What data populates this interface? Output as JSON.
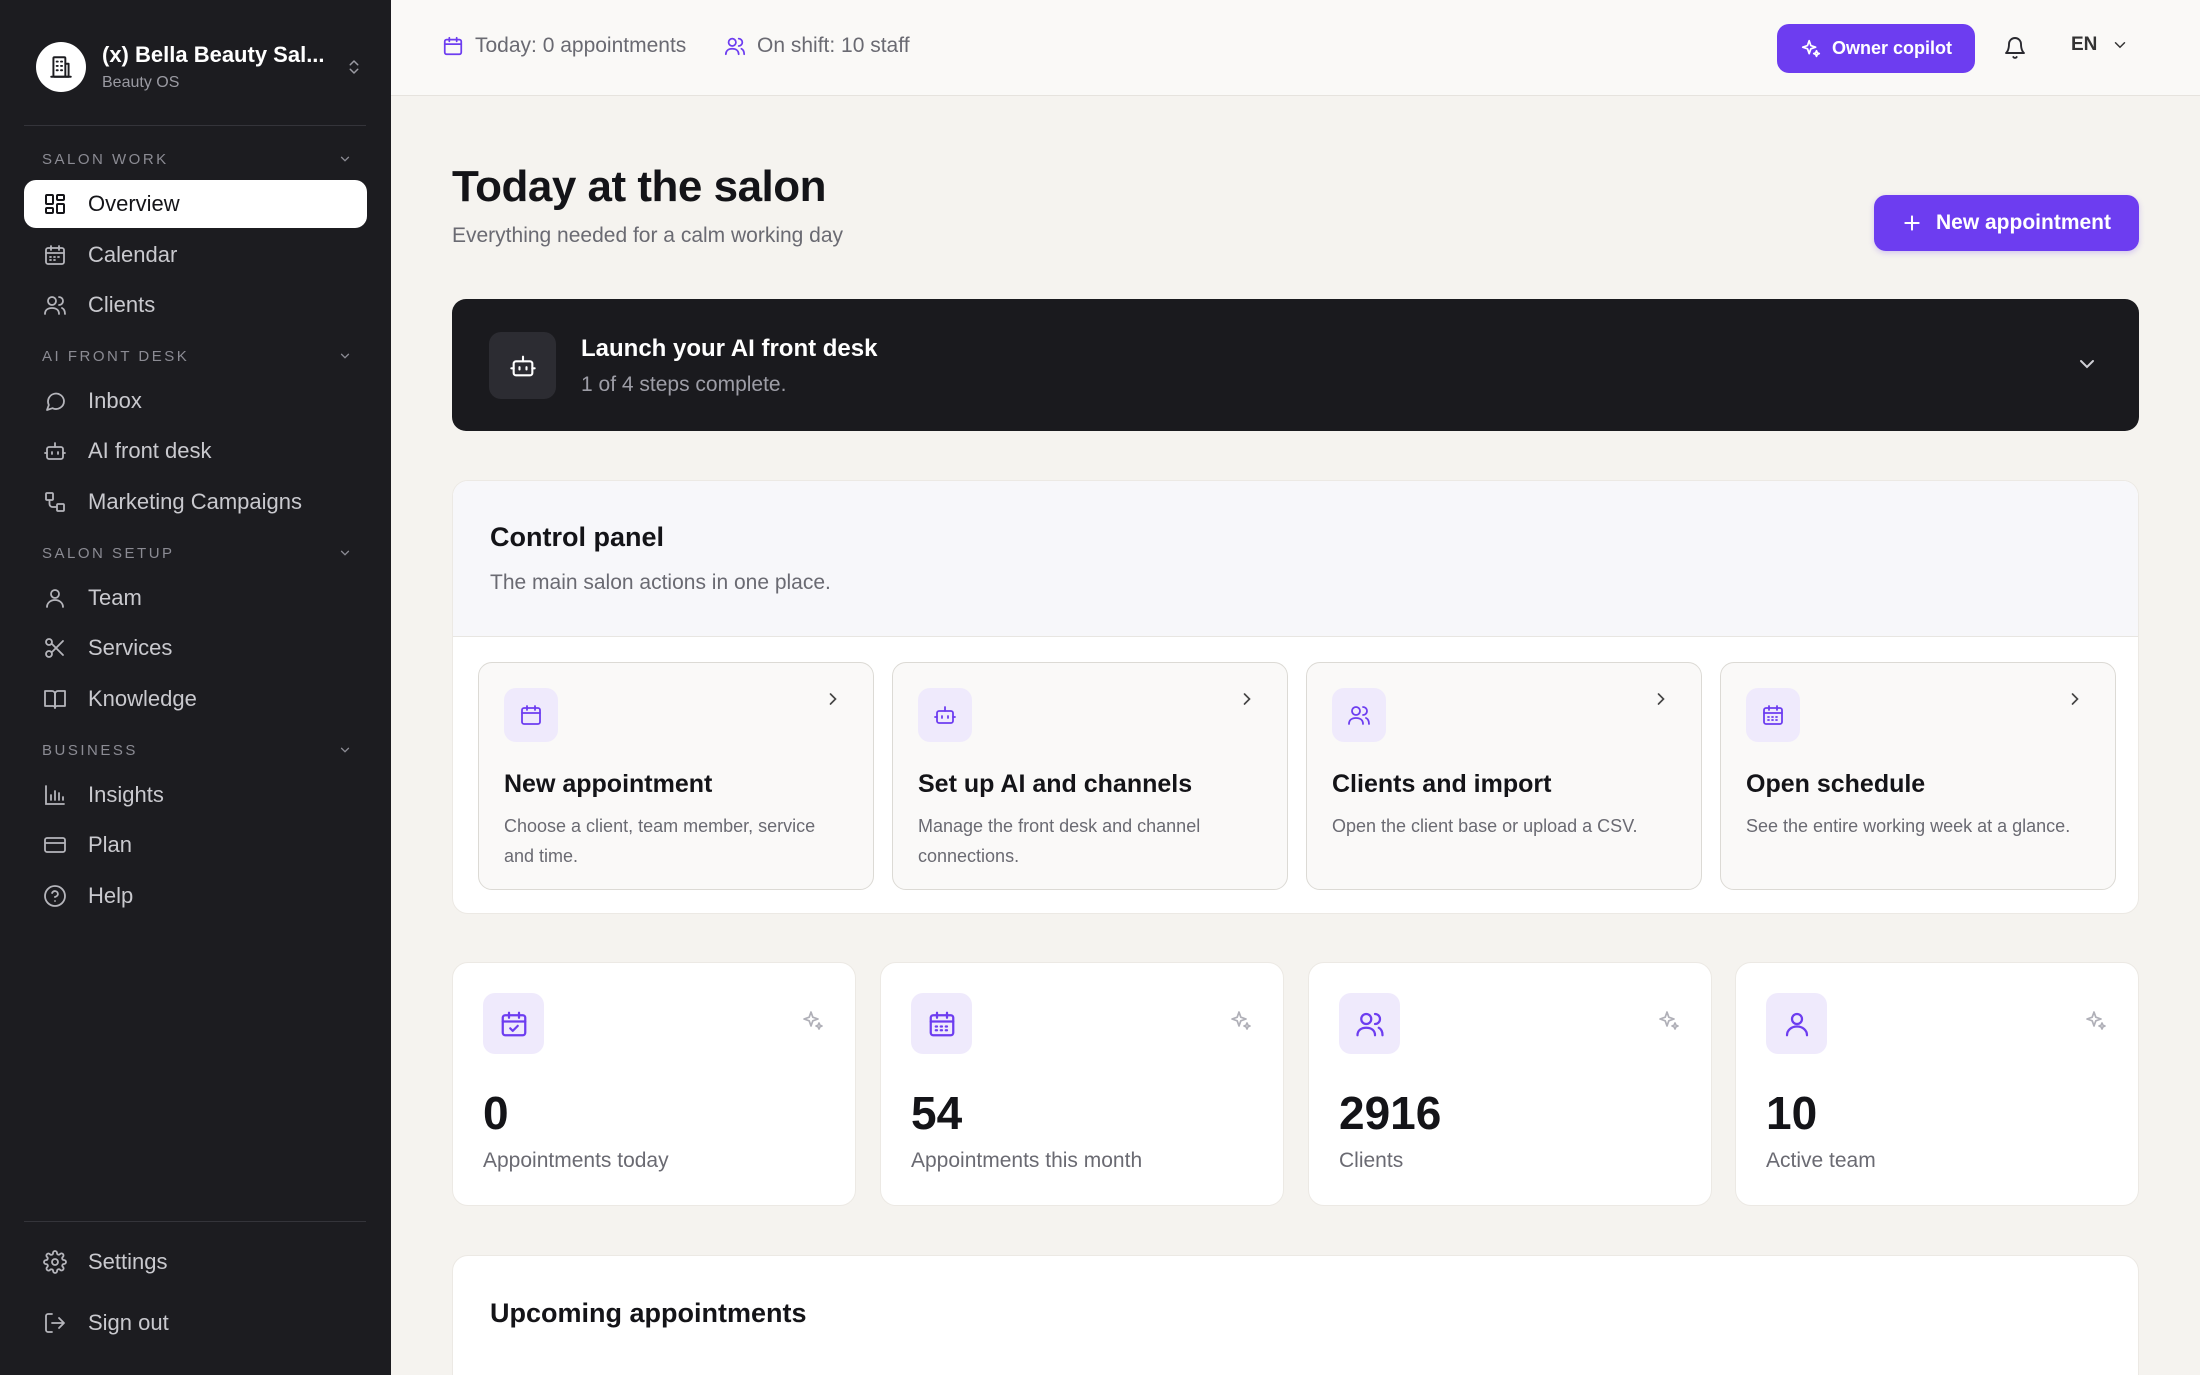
{
  "brand": {
    "name": "(x) Bella Beauty Sal...",
    "subtitle": "Beauty OS"
  },
  "sidebar": {
    "sections": [
      {
        "title": "SALON WORK",
        "items": [
          {
            "label": "Overview",
            "icon": "overview-icon",
            "active": true
          },
          {
            "label": "Calendar",
            "icon": "calendar-icon"
          },
          {
            "label": "Clients",
            "icon": "clients-icon"
          }
        ]
      },
      {
        "title": "AI FRONT DESK",
        "items": [
          {
            "label": "Inbox",
            "icon": "chat-bubble-icon"
          },
          {
            "label": "AI front desk",
            "icon": "robot-icon"
          },
          {
            "label": "Marketing Campaigns",
            "icon": "campaigns-icon"
          }
        ]
      },
      {
        "title": "SALON SETUP",
        "items": [
          {
            "label": "Team",
            "icon": "person-icon"
          },
          {
            "label": "Services",
            "icon": "scissors-icon"
          },
          {
            "label": "Knowledge",
            "icon": "book-icon"
          }
        ]
      },
      {
        "title": "BUSINESS",
        "items": [
          {
            "label": "Insights",
            "icon": "bar-chart-icon"
          },
          {
            "label": "Plan",
            "icon": "credit-card-icon"
          },
          {
            "label": "Help",
            "icon": "help-circle-icon"
          }
        ]
      }
    ],
    "footer": {
      "settings": "Settings",
      "sign_out": "Sign out"
    }
  },
  "topbar": {
    "today": "Today: 0 appointments",
    "shift": "On shift: 10 staff",
    "copilot": "Owner copilot",
    "language": "EN"
  },
  "page": {
    "title": "Today at the salon",
    "subtitle": "Everything needed for a calm working day",
    "new_appointment": "New appointment"
  },
  "launch": {
    "title": "Launch your AI front desk",
    "progress": "1 of 4 steps complete.",
    "steps_done": 1,
    "steps_total": 4
  },
  "control": {
    "title": "Control panel",
    "subtitle": "The main salon actions in one place.",
    "actions": [
      {
        "title": "New appointment",
        "desc": "Choose a client, team member, service and time.",
        "icon": "calendar-icon"
      },
      {
        "title": "Set up AI and channels",
        "desc": "Manage the front desk and channel connections.",
        "icon": "robot-icon"
      },
      {
        "title": "Clients and import",
        "desc": "Open the client base or upload a CSV.",
        "icon": "clients-icon"
      },
      {
        "title": "Open schedule",
        "desc": "See the entire working week at a glance.",
        "icon": "schedule-icon"
      }
    ]
  },
  "stats": [
    {
      "value": "0",
      "label": "Appointments today",
      "icon": "calendar-check-icon"
    },
    {
      "value": "54",
      "label": "Appointments this month",
      "icon": "calendar-grid-icon"
    },
    {
      "value": "2916",
      "label": "Clients",
      "icon": "clients-icon"
    },
    {
      "value": "10",
      "label": "Active team",
      "icon": "person-icon"
    }
  ],
  "upcoming": {
    "title": "Upcoming appointments"
  },
  "colors": {
    "accent": "#6d3df0",
    "sidebar": "#1c1c20",
    "background": "#f5f3ef"
  }
}
